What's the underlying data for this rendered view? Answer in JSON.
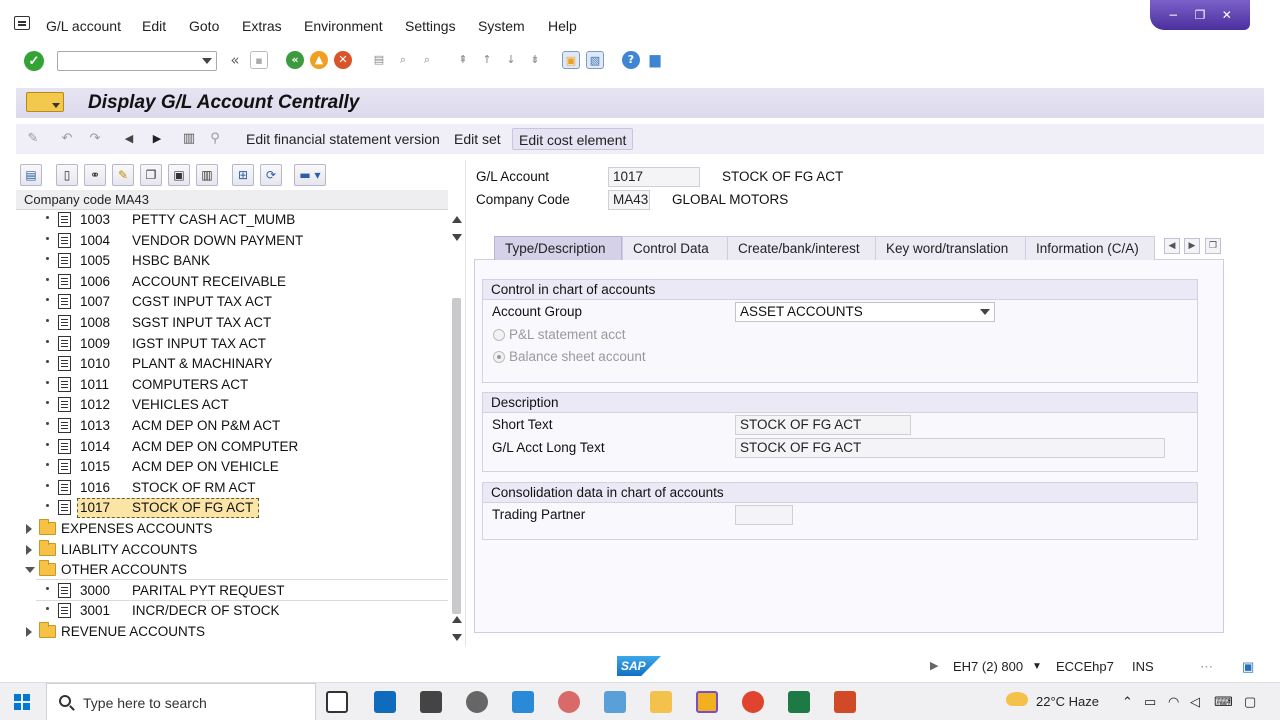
{
  "menu": {
    "items": [
      "G/L account",
      "Edit",
      "Goto",
      "Extras",
      "Environment",
      "Settings",
      "System",
      "Help"
    ]
  },
  "window_controls": [
    "−",
    "❐",
    "✕"
  ],
  "header": {
    "title": "Display G/L Account Centrally"
  },
  "app_toolbar": {
    "edit_fs_version": "Edit financial statement version",
    "edit_set": "Edit set",
    "edit_cost_element": "Edit cost element"
  },
  "tree": {
    "header": "Company code MA43",
    "accounts": [
      {
        "num": "1003",
        "text": "PETTY CASH ACT_MUMB"
      },
      {
        "num": "1004",
        "text": "VENDOR DOWN PAYMENT"
      },
      {
        "num": "1005",
        "text": "HSBC BANK"
      },
      {
        "num": "1006",
        "text": "ACCOUNT RECEIVABLE"
      },
      {
        "num": "1007",
        "text": "CGST INPUT TAX ACT"
      },
      {
        "num": "1008",
        "text": "SGST INPUT TAX ACT"
      },
      {
        "num": "1009",
        "text": "IGST INPUT TAX ACT"
      },
      {
        "num": "1010",
        "text": "PLANT & MACHINARY"
      },
      {
        "num": "1011",
        "text": "COMPUTERS ACT"
      },
      {
        "num": "1012",
        "text": "VEHICLES ACT"
      },
      {
        "num": "1013",
        "text": "ACM DEP ON P&M ACT"
      },
      {
        "num": "1014",
        "text": "ACM DEP ON COMPUTER"
      },
      {
        "num": "1015",
        "text": "ACM DEP ON VEHICLE"
      },
      {
        "num": "1016",
        "text": "STOCK OF RM ACT"
      },
      {
        "num": "1017",
        "text": "STOCK OF FG ACT"
      }
    ],
    "folders": {
      "expenses": "EXPENSES ACCOUNTS",
      "liability": "LIABLITY ACCOUNTS",
      "other": "OTHER ACCOUNTS",
      "revenue": "REVENUE ACCOUNTS"
    },
    "other_accounts": [
      {
        "num": "3000",
        "text": "PARITAL PYT REQUEST"
      },
      {
        "num": "3001",
        "text": "INCR/DECR OF STOCK"
      }
    ]
  },
  "detail": {
    "gl_account_label": "G/L Account",
    "gl_account_value": "1017",
    "gl_account_name": "STOCK OF FG ACT",
    "company_code_label": "Company Code",
    "company_code_value": "MA43",
    "company_name": "GLOBAL MOTORS"
  },
  "tabs": [
    "Type/Description",
    "Control Data",
    "Create/bank/interest",
    "Key word/translation",
    "Information (C/A)"
  ],
  "control_group": {
    "title": "Control in chart of accounts",
    "account_group_label": "Account Group",
    "account_group_value": "ASSET ACCOUNTS",
    "radio_pl": "P&L statement acct",
    "radio_bs": "Balance sheet account"
  },
  "description_group": {
    "title": "Description",
    "short_text_label": "Short Text",
    "short_text_value": "STOCK OF FG ACT",
    "long_text_label": "G/L Acct Long Text",
    "long_text_value": "STOCK OF FG ACT"
  },
  "consolidation_group": {
    "title": "Consolidation data in chart of accounts",
    "trading_partner_label": "Trading Partner",
    "trading_partner_value": ""
  },
  "status": {
    "logo": "SAP",
    "system": "EH7 (2) 800",
    "server": "ECCEhp7",
    "mode": "INS"
  },
  "taskbar": {
    "search_placeholder": "Type here to search",
    "weather": "22°C Haze"
  }
}
